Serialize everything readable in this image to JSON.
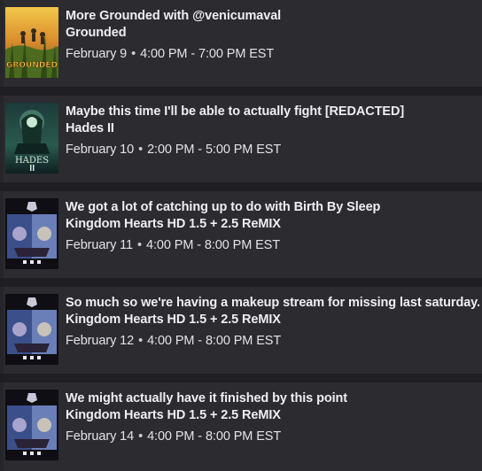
{
  "schedule": [
    {
      "title": "More Grounded with @venicumaval",
      "game": "Grounded",
      "date": "February 9",
      "separator": "•",
      "time": "4:00 PM - 7:00 PM EST",
      "cover_text": "GROUNDED",
      "cover_icon": "grounded-cover-icon"
    },
    {
      "title": "Maybe this time I'll be able to actually fight [REDACTED]",
      "game": "Hades II",
      "date": "February 10",
      "separator": "•",
      "time": "2:00 PM - 5:00 PM EST",
      "cover_text": "HADES",
      "cover_icon": "hades-cover-icon"
    },
    {
      "title": "We got a lot of catching up to do with Birth By Sleep",
      "game": "Kingdom Hearts HD 1.5 + 2.5 ReMIX",
      "date": "February 11",
      "separator": "•",
      "time": "4:00 PM - 8:00 PM EST",
      "cover_icon": "kingdom-hearts-cover-icon"
    },
    {
      "title": "So much so we're having a makeup stream for missing last saturday.",
      "game": "Kingdom Hearts HD 1.5 + 2.5 ReMIX",
      "date": "February 12",
      "separator": "•",
      "time": "4:00 PM - 8:00 PM EST",
      "cover_icon": "kingdom-hearts-cover-icon"
    },
    {
      "title": "We might actually have it finished by this point",
      "game": "Kingdom Hearts HD 1.5 + 2.5 ReMIX",
      "date": "February 14",
      "separator": "•",
      "time": "4:00 PM - 8:00 PM EST",
      "cover_icon": "kingdom-hearts-cover-icon"
    }
  ],
  "colors": {
    "page_background": "#1f1f23",
    "card_background": "#2b2b30",
    "text_primary": "#efeff1"
  }
}
